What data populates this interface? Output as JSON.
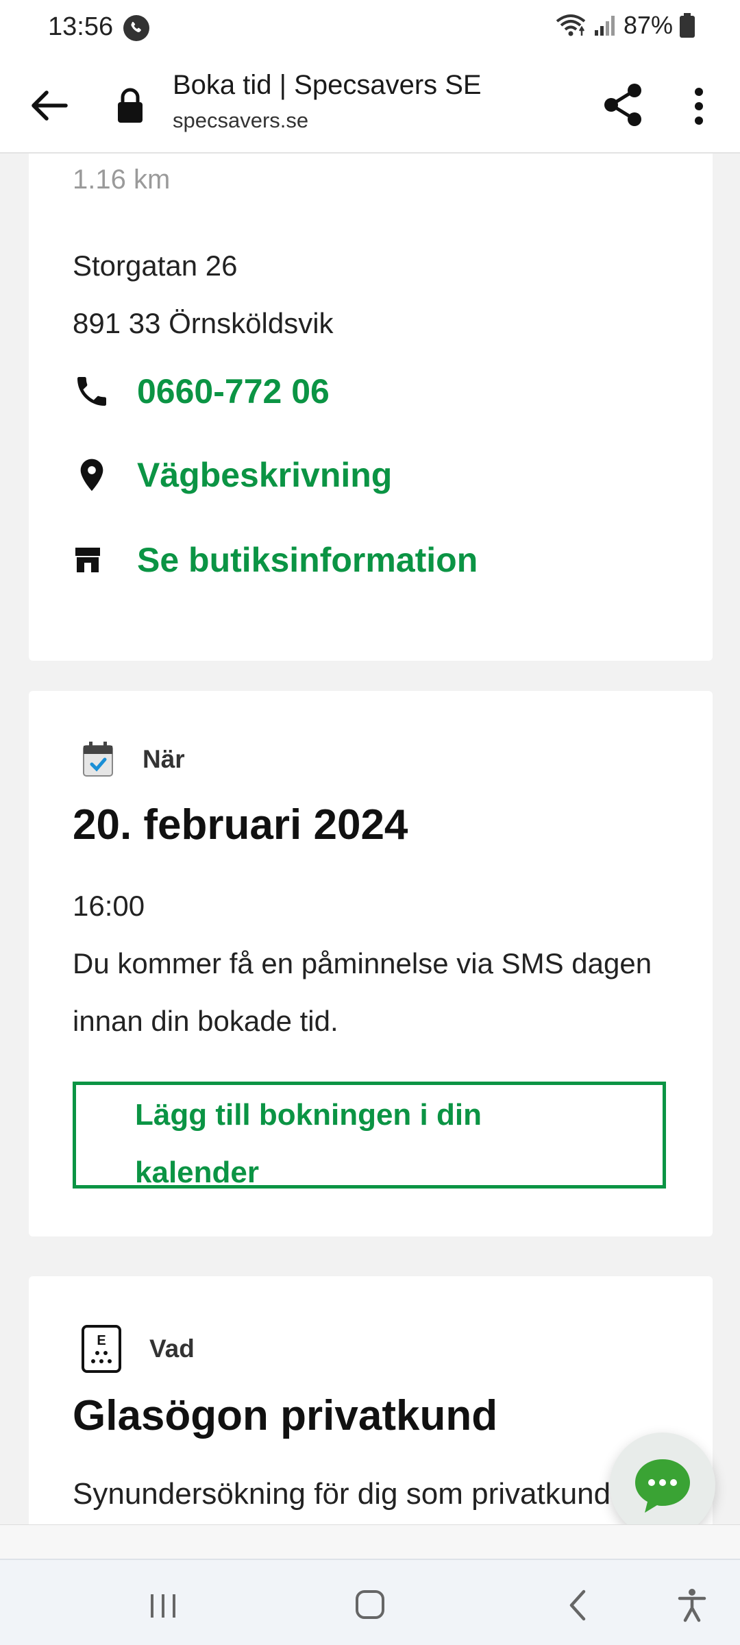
{
  "status_bar": {
    "time": "13:56",
    "battery": "87%"
  },
  "browser": {
    "title": "Boka tid | Specsavers SE",
    "url": "specsavers.se"
  },
  "store_card": {
    "distance": "1.16 km",
    "address_line1": "Storgatan 26",
    "address_line2": "891 33 Örnsköldsvik",
    "phone": "0660-772 06",
    "directions": "Vägbeskrivning",
    "store_info": "Se butiksinformation"
  },
  "when_card": {
    "label": "När",
    "date": "20. februari 2024",
    "time": "16:00",
    "reminder": "Du kommer få en påminnelse via SMS dagen innan din bokade tid.",
    "calendar_button": "Lägg till bokningen i din kalender"
  },
  "what_card": {
    "label": "Vad",
    "title": "Glasögon privatkund",
    "description": "Synundersökning för dig som privatkund."
  },
  "colors": {
    "accent_green": "#0b9444"
  }
}
